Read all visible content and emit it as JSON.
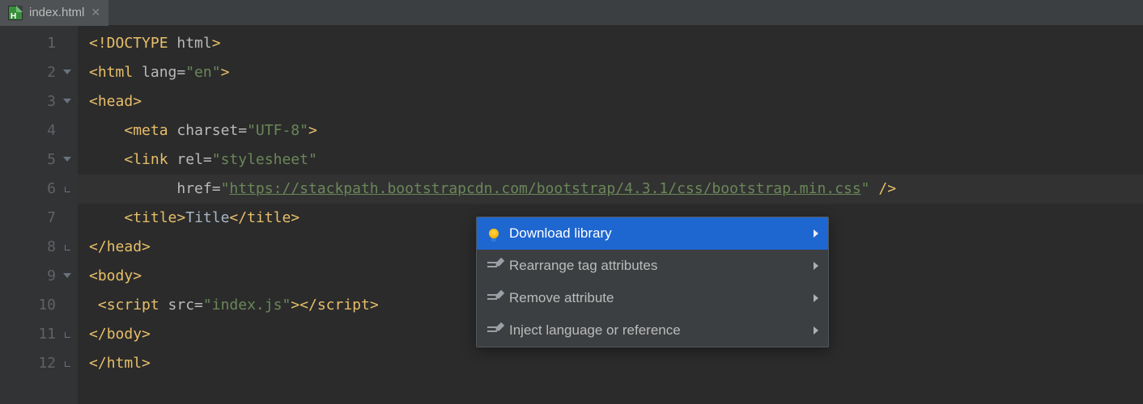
{
  "tab": {
    "filename": "index.html"
  },
  "gutter": {
    "lines": [
      "1",
      "2",
      "3",
      "4",
      "5",
      "6",
      "7",
      "8",
      "9",
      "10",
      "11",
      "12"
    ]
  },
  "code": {
    "l1": {
      "p1": "<!DOCTYPE ",
      "p2": "html",
      "p3": ">"
    },
    "l2": {
      "open": "<",
      "tag": "html ",
      "attr": "lang=",
      "val": "\"en\"",
      "close": ">"
    },
    "l3": {
      "open": "<",
      "tag": "head",
      "close": ">"
    },
    "l4": {
      "indent": "    ",
      "open": "<",
      "tag": "meta ",
      "attr": "charset=",
      "val": "\"UTF-8\"",
      "close": ">"
    },
    "l5": {
      "indent": "    ",
      "open": "<",
      "tag": "link ",
      "attr": "rel=",
      "val": "\"stylesheet\""
    },
    "l6": {
      "indent": "          ",
      "attr": "href=",
      "q1": "\"",
      "url": "https://stackpath.bootstrapcdn.com/bootstrap/4.3.1/css/bootstrap.min.css",
      "q2": "\"",
      "close": " />"
    },
    "l7": {
      "indent": "    ",
      "open": "<",
      "tag": "title",
      "close1": ">",
      "text": "Title",
      "open2": "</",
      "tag2": "title",
      "close2": ">"
    },
    "l8": {
      "open": "</",
      "tag": "head",
      "close": ">"
    },
    "l9": {
      "open": "<",
      "tag": "body",
      "close": ">"
    },
    "l10": {
      "indent": " ",
      "open": "<",
      "tag": "script ",
      "attr": "src=",
      "val": "\"index.js\"",
      "close1": ">",
      "open2": "</",
      "tag2": "script",
      "close2": ">"
    },
    "l11": {
      "open": "</",
      "tag": "body",
      "close": ">"
    },
    "l12": {
      "open": "</",
      "tag": "html",
      "close": ">"
    }
  },
  "popup": {
    "items": [
      "Download library",
      "Rearrange tag attributes",
      "Remove attribute",
      "Inject language or reference"
    ]
  }
}
